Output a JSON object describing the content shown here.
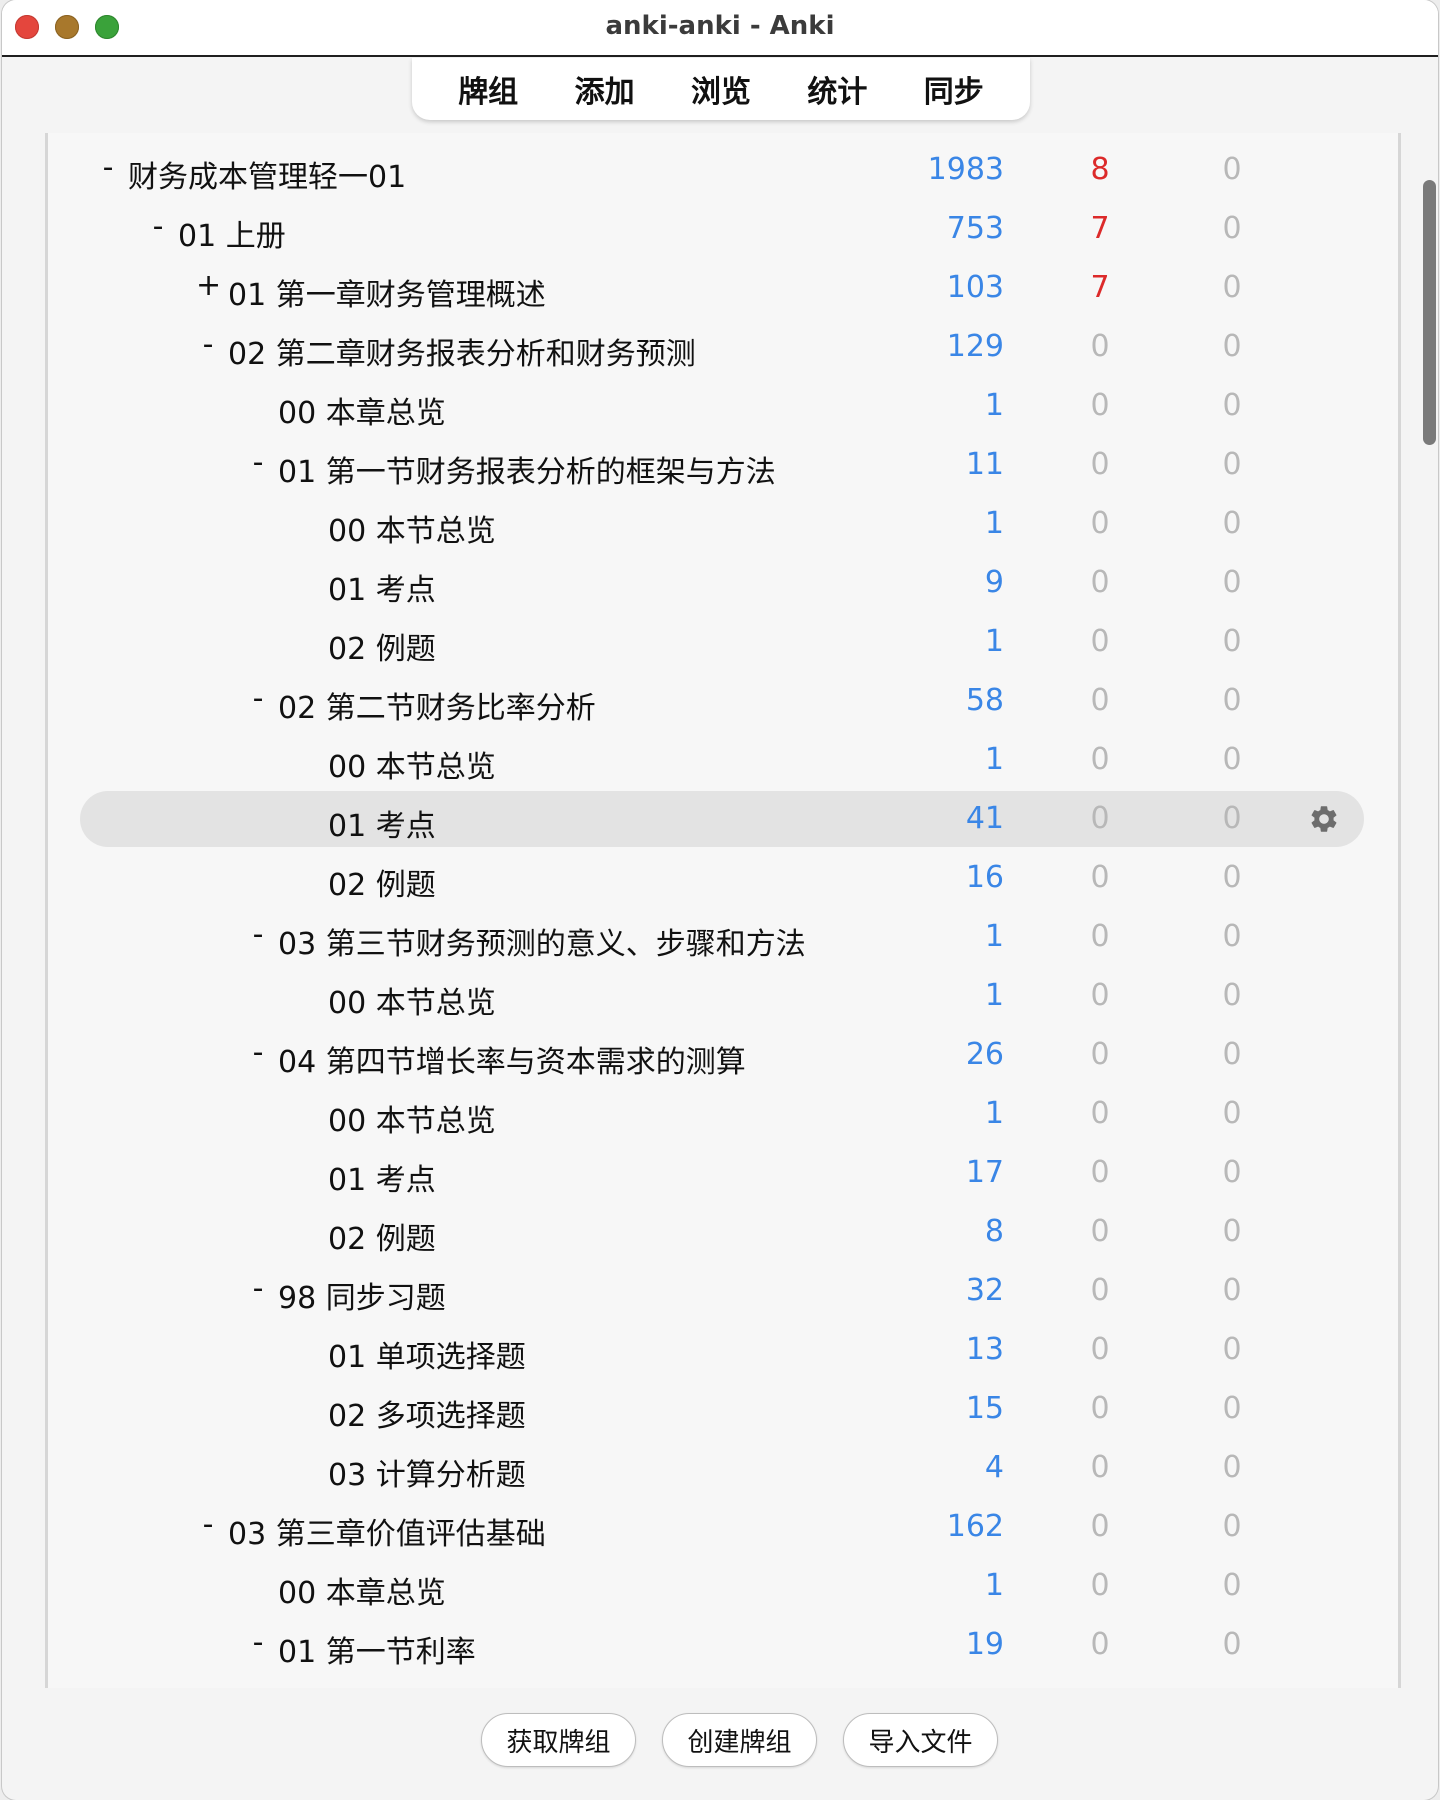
{
  "window": {
    "title": "anki-anki - Anki"
  },
  "toolbar": {
    "items": [
      "牌组",
      "添加",
      "浏览",
      "统计",
      "同步"
    ]
  },
  "decks": [
    {
      "expander": "-",
      "name": "财务成本管理轻一01",
      "new": "1983",
      "learn": "8",
      "due": "0",
      "new_color": "blue",
      "learn_color": "red"
    },
    {
      "expander": "-",
      "name": "01 上册",
      "new": "753",
      "learn": "7",
      "due": "0",
      "new_color": "blue",
      "learn_color": "red"
    },
    {
      "expander": "+",
      "name": "01 第一章财务管理概述",
      "new": "103",
      "learn": "7",
      "due": "0",
      "new_color": "blue",
      "learn_color": "red"
    },
    {
      "expander": "-",
      "name": "02 第二章财务报表分析和财务预测",
      "new": "129",
      "learn": "0",
      "due": "0",
      "new_color": "blue",
      "learn_color": "grey"
    },
    {
      "expander": "",
      "name": "00 本章总览",
      "new": "1",
      "learn": "0",
      "due": "0",
      "new_color": "blue",
      "learn_color": "grey"
    },
    {
      "expander": "-",
      "name": "01 第一节财务报表分析的框架与方法",
      "new": "11",
      "learn": "0",
      "due": "0",
      "new_color": "blue",
      "learn_color": "grey"
    },
    {
      "expander": "",
      "name": "00 本节总览",
      "new": "1",
      "learn": "0",
      "due": "0",
      "new_color": "blue",
      "learn_color": "grey"
    },
    {
      "expander": "",
      "name": "01 考点",
      "new": "9",
      "learn": "0",
      "due": "0",
      "new_color": "blue",
      "learn_color": "grey"
    },
    {
      "expander": "",
      "name": "02 例题",
      "new": "1",
      "learn": "0",
      "due": "0",
      "new_color": "blue",
      "learn_color": "grey"
    },
    {
      "expander": "-",
      "name": "02 第二节财务比率分析",
      "new": "58",
      "learn": "0",
      "due": "0",
      "new_color": "blue",
      "learn_color": "grey"
    },
    {
      "expander": "",
      "name": "00 本节总览",
      "new": "1",
      "learn": "0",
      "due": "0",
      "new_color": "blue",
      "learn_color": "grey"
    },
    {
      "expander": "",
      "name": "01 考点",
      "new": "41",
      "learn": "0",
      "due": "0",
      "new_color": "blue",
      "learn_color": "grey"
    },
    {
      "expander": "",
      "name": "02 例题",
      "new": "16",
      "learn": "0",
      "due": "0",
      "new_color": "blue",
      "learn_color": "grey"
    },
    {
      "expander": "-",
      "name": "03 第三节财务预测的意义、步骤和方法",
      "new": "1",
      "learn": "0",
      "due": "0",
      "new_color": "blue",
      "learn_color": "grey"
    },
    {
      "expander": "",
      "name": "00 本节总览",
      "new": "1",
      "learn": "0",
      "due": "0",
      "new_color": "blue",
      "learn_color": "grey"
    },
    {
      "expander": "-",
      "name": "04 第四节增长率与资本需求的测算",
      "new": "26",
      "learn": "0",
      "due": "0",
      "new_color": "blue",
      "learn_color": "grey"
    },
    {
      "expander": "",
      "name": "00 本节总览",
      "new": "1",
      "learn": "0",
      "due": "0",
      "new_color": "blue",
      "learn_color": "grey"
    },
    {
      "expander": "",
      "name": "01 考点",
      "new": "17",
      "learn": "0",
      "due": "0",
      "new_color": "blue",
      "learn_color": "grey"
    },
    {
      "expander": "",
      "name": "02 例题",
      "new": "8",
      "learn": "0",
      "due": "0",
      "new_color": "blue",
      "learn_color": "grey"
    },
    {
      "expander": "-",
      "name": "98 同步习题",
      "new": "32",
      "learn": "0",
      "due": "0",
      "new_color": "blue",
      "learn_color": "grey"
    },
    {
      "expander": "",
      "name": "01 单项选择题",
      "new": "13",
      "learn": "0",
      "due": "0",
      "new_color": "blue",
      "learn_color": "grey"
    },
    {
      "expander": "",
      "name": "02 多项选择题",
      "new": "15",
      "learn": "0",
      "due": "0",
      "new_color": "blue",
      "learn_color": "grey"
    },
    {
      "expander": "",
      "name": "03 计算分析题",
      "new": "4",
      "learn": "0",
      "due": "0",
      "new_color": "blue",
      "learn_color": "grey"
    },
    {
      "expander": "-",
      "name": "03 第三章价值评估基础",
      "new": "162",
      "learn": "0",
      "due": "0",
      "new_color": "blue",
      "learn_color": "grey"
    },
    {
      "expander": "",
      "name": "00 本章总览",
      "new": "1",
      "learn": "0",
      "due": "0",
      "new_color": "blue",
      "learn_color": "grey"
    },
    {
      "expander": "-",
      "name": "01 第一节利率",
      "new": "19",
      "learn": "0",
      "due": "0",
      "new_color": "blue",
      "learn_color": "grey"
    }
  ],
  "selected_index": 11,
  "icons": {
    "deck_options": "gear-icon"
  },
  "bottom_buttons": {
    "get_shared": "获取牌组",
    "create_deck": "创建牌组",
    "import_file": "导入文件"
  }
}
